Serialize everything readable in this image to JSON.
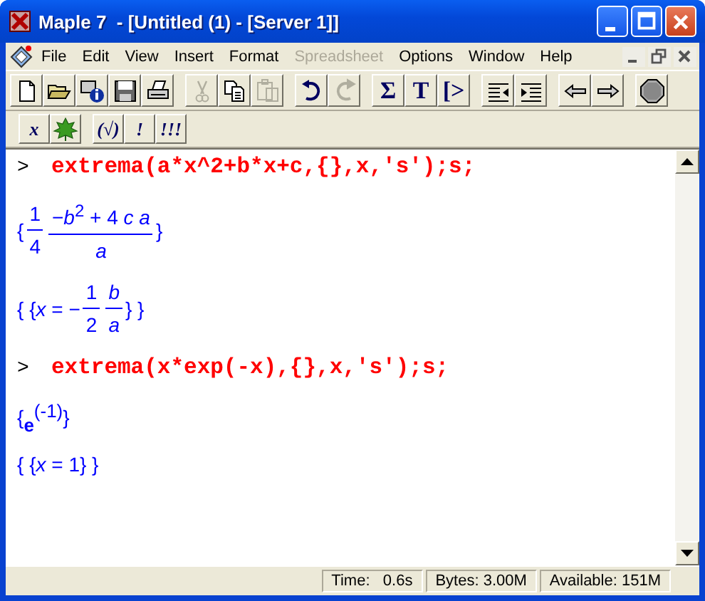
{
  "window": {
    "title": "Maple 7  - [Untitled (1) - [Server 1]]"
  },
  "menu": [
    {
      "label": "File",
      "disabled": false
    },
    {
      "label": "Edit",
      "disabled": false
    },
    {
      "label": "View",
      "disabled": false
    },
    {
      "label": "Insert",
      "disabled": false
    },
    {
      "label": "Format",
      "disabled": false
    },
    {
      "label": "Spreadsheet",
      "disabled": true
    },
    {
      "label": "Options",
      "disabled": false
    },
    {
      "label": "Window",
      "disabled": false
    },
    {
      "label": "Help",
      "disabled": false
    }
  ],
  "toolbar": [
    [
      {
        "kind": "new",
        "disabled": false
      },
      {
        "kind": "open",
        "disabled": false
      },
      {
        "kind": "info",
        "disabled": false
      },
      {
        "kind": "save",
        "disabled": false
      },
      {
        "kind": "print",
        "disabled": false
      }
    ],
    [
      {
        "kind": "cut",
        "disabled": true
      },
      {
        "kind": "copy",
        "disabled": false
      },
      {
        "kind": "paste",
        "disabled": true
      }
    ],
    [
      {
        "kind": "undo",
        "disabled": false
      },
      {
        "kind": "redo",
        "disabled": true
      }
    ],
    [
      {
        "kind": "text",
        "label": "Σ",
        "disabled": false
      },
      {
        "kind": "text",
        "label": "T",
        "disabled": false
      },
      {
        "kind": "text",
        "label": "[>",
        "disabled": false
      }
    ],
    [
      {
        "kind": "outdent",
        "disabled": false
      },
      {
        "kind": "indent",
        "disabled": false
      }
    ],
    [
      {
        "kind": "back",
        "disabled": false
      },
      {
        "kind": "forward",
        "disabled": false
      }
    ],
    [
      {
        "kind": "stop",
        "disabled": false
      }
    ]
  ],
  "context_bar": [
    [
      {
        "kind": "text",
        "label": "x"
      },
      {
        "kind": "leaf"
      }
    ],
    [
      {
        "kind": "text",
        "label": "(√)"
      },
      {
        "kind": "text",
        "label": "!"
      },
      {
        "kind": "text",
        "label": "!!!"
      }
    ]
  ],
  "worksheet": [
    {
      "kind": "input",
      "prompt": ">",
      "text": "extrema(a*x^2+b*x+c,{},x,'s');s;"
    },
    {
      "kind": "output",
      "parts": [
        {
          "kind": "text",
          "text": "{"
        },
        {
          "kind": "frac",
          "num": "1",
          "den": "4"
        },
        {
          "kind": "frac",
          "num": "−*b*$^{2}$ + 4 *c a*",
          "den": "*a*"
        },
        {
          "kind": "text",
          "text": "}"
        }
      ]
    },
    {
      "kind": "output",
      "parts": [
        {
          "kind": "text",
          "text": "{ {*x* = −"
        },
        {
          "kind": "frac",
          "num": "1",
          "den": "2"
        },
        {
          "kind": "frac",
          "num": "*b*",
          "den": "*a*"
        },
        {
          "kind": "text",
          "text": "} }"
        }
      ]
    },
    {
      "kind": "input",
      "prompt": ">",
      "text": "extrema(x*exp(-x),{},x,'s');s;"
    },
    {
      "kind": "output",
      "parts": [
        {
          "kind": "text",
          "text": "{"
        },
        {
          "kind": "power",
          "base": "e",
          "exp": "(-1)"
        },
        {
          "kind": "text",
          "text": "}"
        }
      ]
    },
    {
      "kind": "output",
      "parts": [
        {
          "kind": "text",
          "text": "{ {*x* = 1} }"
        }
      ]
    }
  ],
  "status_bar": [
    "Time:   0.6s",
    "Bytes: 3.00M",
    "Available: 151M"
  ]
}
